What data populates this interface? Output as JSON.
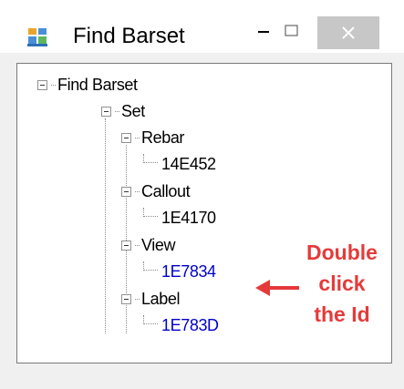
{
  "window": {
    "title": "Find Barset",
    "icon": "winforms-app-icon",
    "controls": [
      "minimize-icon",
      "maximize-icon",
      "close-icon"
    ]
  },
  "tree": {
    "root": {
      "label": "Find Barset",
      "expanded": true
    },
    "set": {
      "label": "Set",
      "expanded": true
    },
    "groups": [
      {
        "label": "Rebar",
        "expanded": true,
        "id": "14E452",
        "id_color": "#000000"
      },
      {
        "label": "Callout",
        "expanded": true,
        "id": "1E4170",
        "id_color": "#000000"
      },
      {
        "label": "View",
        "expanded": true,
        "id": "1E7834",
        "id_color": "#0000cc"
      },
      {
        "label": "Label",
        "expanded": true,
        "id": "1E783D",
        "id_color": "#0000cc"
      }
    ]
  },
  "annotation": {
    "lines": [
      "Double",
      "click",
      "the Id"
    ],
    "color": "#e53a3a",
    "arrow": "left-arrow-icon"
  },
  "colors": {
    "link": "#0000cc",
    "close_button_bg": "#c7c7c7",
    "window_bg": "#f0f0f0"
  }
}
